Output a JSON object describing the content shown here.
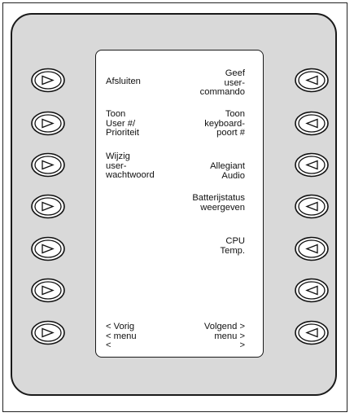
{
  "left_labels": [
    "Afsluiten",
    "Toon\nUser #/\nPrioriteit",
    "Wijzig\nuser-\nwachtwoord",
    "",
    "",
    "",
    "< Vorig\n< menu\n<"
  ],
  "right_labels": [
    "Geef\nuser-\ncommando",
    "Toon\nkeyboard-\npoort #",
    "Allegiant\nAudio",
    "Batterijstatus\nweergeven",
    "CPU\nTemp.",
    "",
    "Volgend >\nmenu >\n>"
  ]
}
